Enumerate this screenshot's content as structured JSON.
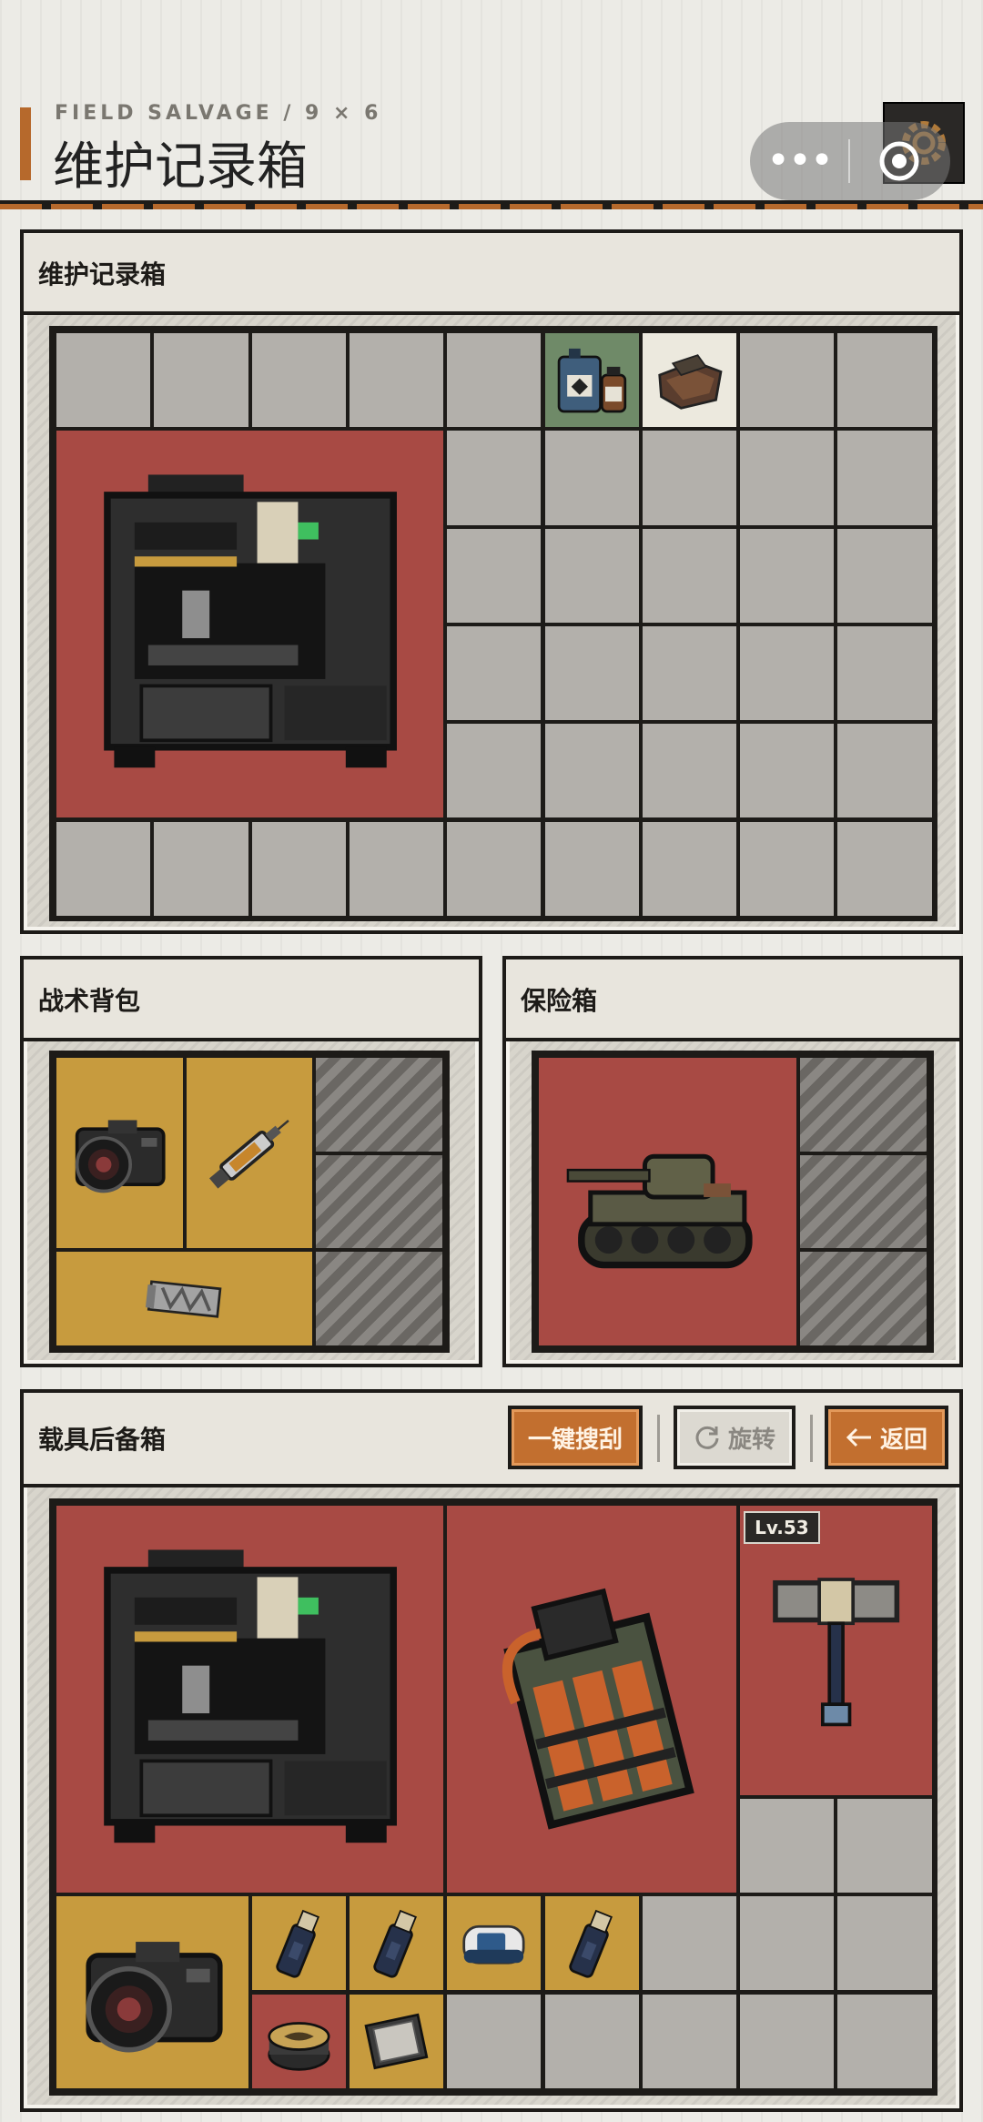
{
  "header": {
    "subtitle": "FIELD SALVAGE / 9 × 6",
    "title": "维护记录箱"
  },
  "capsule": {
    "more_label": "•••"
  },
  "panels": {
    "record_box": {
      "title": "维护记录箱"
    },
    "backpack": {
      "title": "战术背包"
    },
    "safe": {
      "title": "保险箱"
    },
    "vehicle": {
      "title": "载具后备箱",
      "buttons": {
        "loot_all": "一键搜刮",
        "rotate": "旋转",
        "back": "返回"
      },
      "level_badge": "Lv.53"
    }
  },
  "icons": {
    "gear": "gear-icon",
    "close": "target-close-icon",
    "rotate": "rotate-icon",
    "back": "arrow-left-icon"
  },
  "colors": {
    "accent": "#b6692c",
    "item_red": "#a84a44",
    "item_gold": "#c79b3e",
    "item_green": "#6f8a68",
    "empty_cell": "#b3b0ab"
  },
  "items": {
    "record_box": [
      "3d-printer",
      "chemical-bottles",
      "cloth-scraps"
    ],
    "backpack": [
      "camera",
      "syringe",
      "metal-crate"
    ],
    "safe": [
      "tank"
    ],
    "vehicle": [
      "3d-printer",
      "battery-pack",
      "hammer",
      "camera",
      "spray-can",
      "spray-can",
      "pulse-oximeter",
      "spray-can",
      "tin-can",
      "cpu-chip"
    ]
  }
}
